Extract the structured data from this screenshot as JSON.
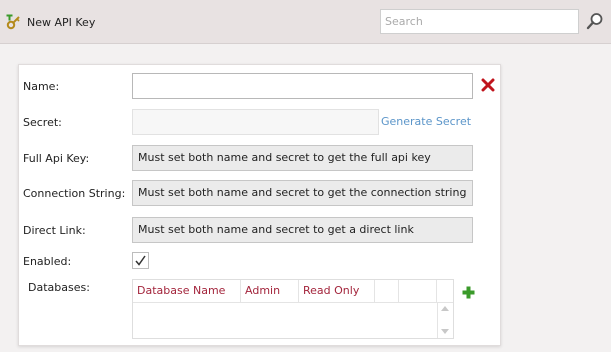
{
  "toolbar": {
    "new_key_label": "New API Key",
    "search_placeholder": "Search",
    "icons": [
      "key-add-icon",
      "search-icon"
    ]
  },
  "form": {
    "name": {
      "label": "Name:",
      "value": ""
    },
    "secret": {
      "label": "Secret:",
      "value": "",
      "generate_label": "Generate Secret"
    },
    "full_api_key": {
      "label": "Full Api Key:",
      "value": "Must set both name and secret to get the full api key"
    },
    "connection_string": {
      "label": "Connection String:",
      "value": "Must set both name and secret to get the connection string"
    },
    "direct_link": {
      "label": "Direct Link:",
      "value": "Must set both name and secret to get a direct link"
    },
    "enabled": {
      "label": "Enabled:",
      "checked": true
    },
    "databases": {
      "label": "Databases:",
      "columns": [
        "Database Name",
        "Admin",
        "Read Only"
      ],
      "rows": []
    }
  },
  "colors": {
    "toolbar_bg": "#e8e2e2",
    "link": "#5b95c9",
    "column_header": "#a3253c",
    "delete": "#c0141c",
    "add": "#3a9a2a"
  }
}
